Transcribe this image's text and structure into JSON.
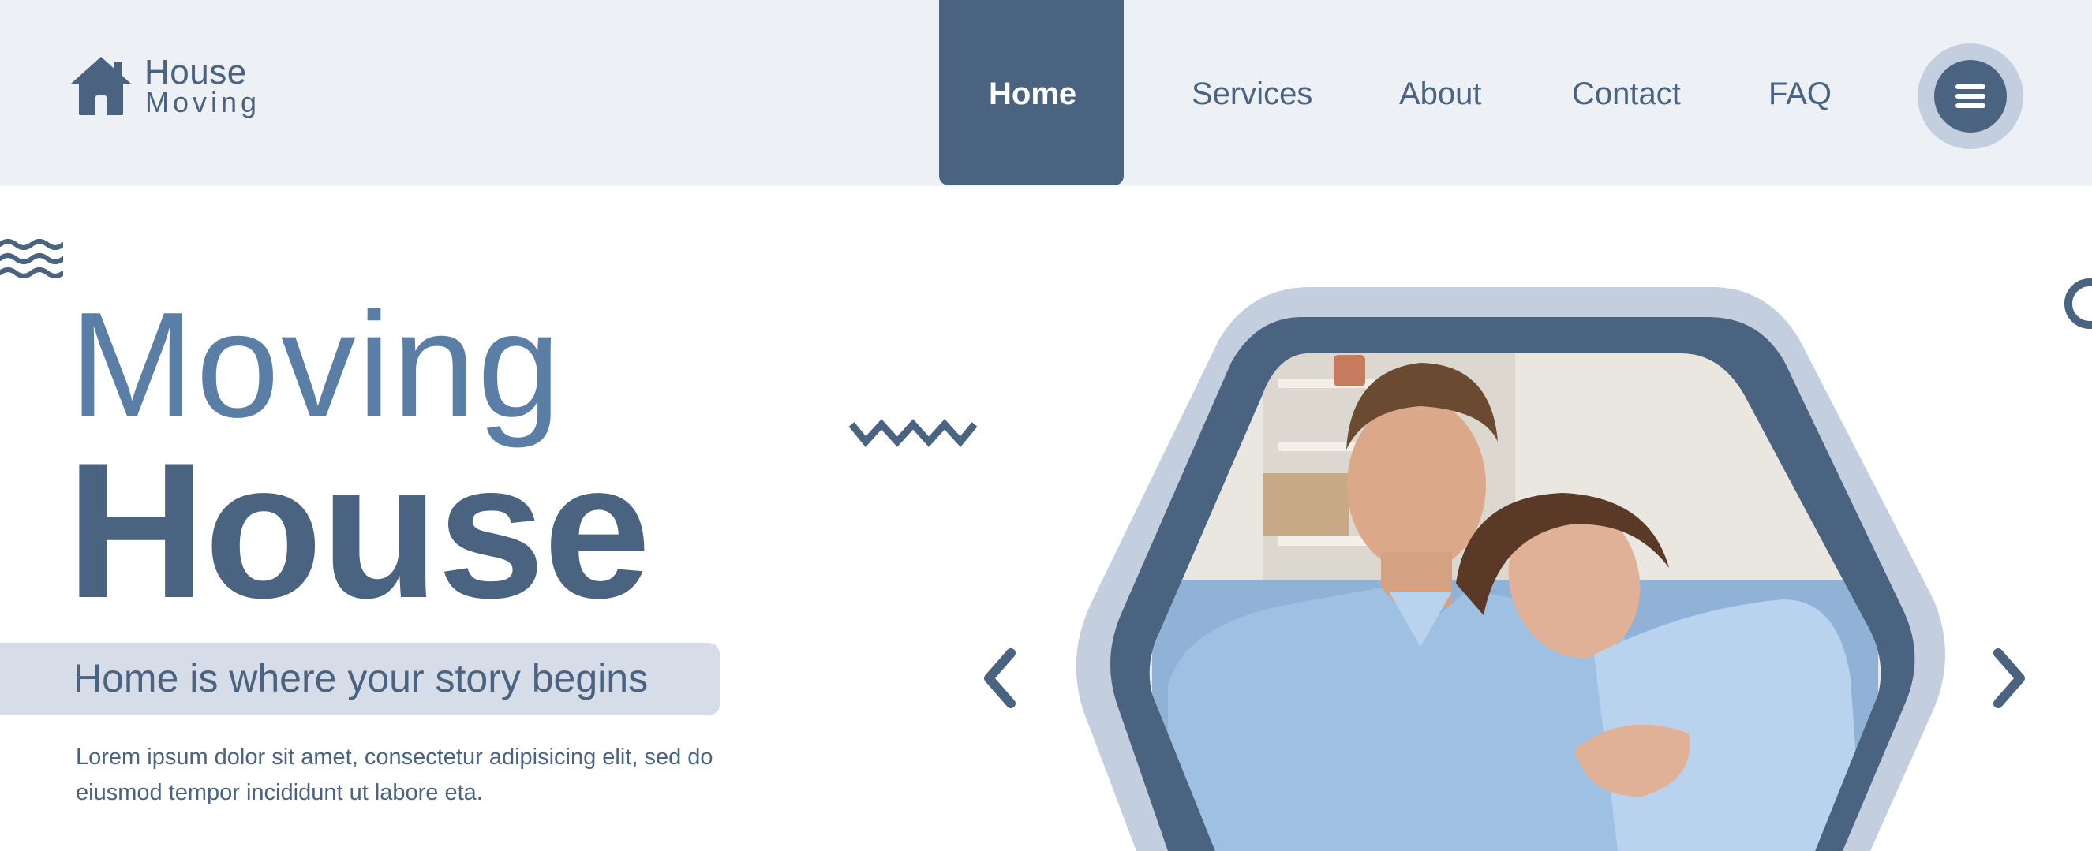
{
  "logo": {
    "title": "House",
    "subtitle": "Moving",
    "icon": "house-icon"
  },
  "nav": {
    "items": [
      {
        "label": "Home",
        "active": true
      },
      {
        "label": "Services",
        "active": false
      },
      {
        "label": "About",
        "active": false
      },
      {
        "label": "Contact",
        "active": false
      },
      {
        "label": "FAQ",
        "active": false
      }
    ],
    "menu_icon": "hamburger-menu-icon"
  },
  "hero": {
    "title_line1": "Moving",
    "title_line2": "House",
    "tagline": "Home is where your story begins",
    "body": "Lorem ipsum dolor sit amet, consectetur adipisicing elit, sed do eiusmod tempor incididunt ut labore eta."
  },
  "carousel": {
    "prev_icon": "chevron-left-icon",
    "next_icon": "chevron-right-icon"
  },
  "colors": {
    "primary": "#4a6380",
    "accent": "#5a7ea5",
    "light": "#c3cfdf",
    "header_bg": "#edf0f5",
    "tagline_bg": "#d6dde9"
  }
}
